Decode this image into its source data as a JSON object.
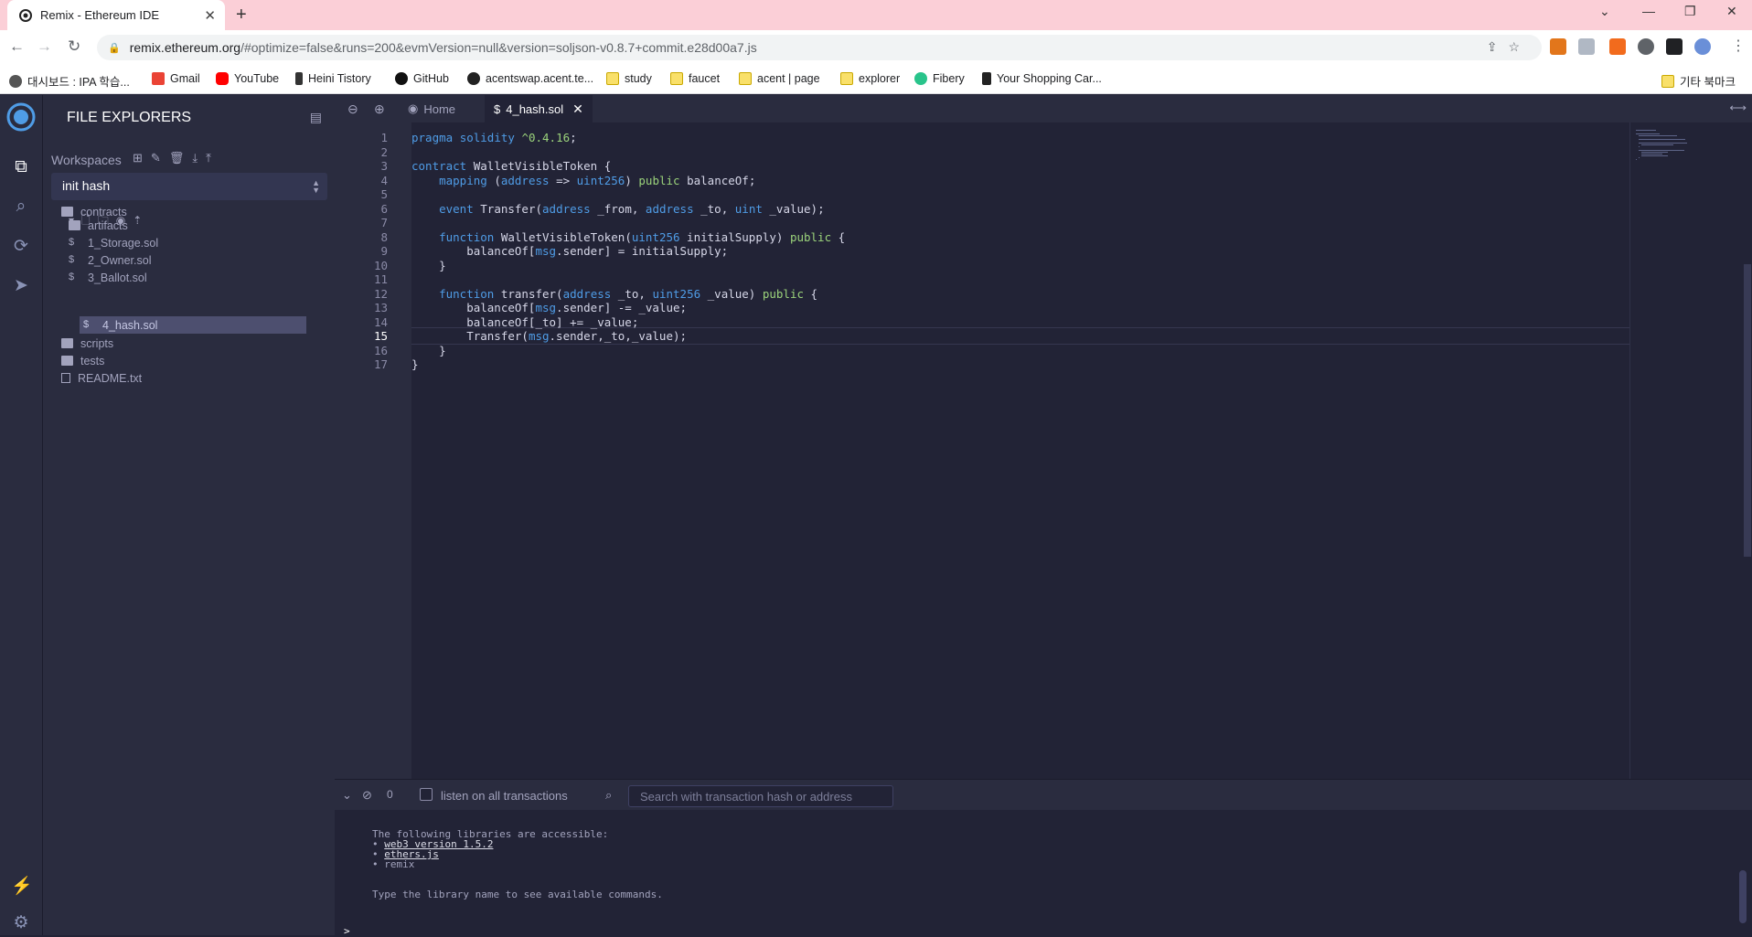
{
  "browser": {
    "tab_title": "Remix - Ethereum IDE",
    "url_host": "remix.ethereum.org",
    "url_rest": "/#optimize=false&runs=200&evmVersion=null&version=soljson-v0.8.7+commit.e28d00a7.js",
    "bookmarks": [
      "대시보드 : IPA 학습...",
      "Gmail",
      "YouTube",
      "Heini Tistory",
      "GitHub",
      "acentswap.acent.te...",
      "study",
      "faucet",
      "acent | page",
      "explorer",
      "Fibery",
      "Your Shopping Car..."
    ],
    "other_bookmarks": "기타 북마크"
  },
  "side_panel": {
    "title": "FILE EXPLORERS",
    "workspaces_label": "Workspaces",
    "workspace_selected": "init hash",
    "tree": [
      {
        "name": "contracts",
        "type": "folder"
      },
      {
        "name": "artifacts",
        "type": "folder"
      },
      {
        "name": "1_Storage.sol",
        "type": "sol"
      },
      {
        "name": "2_Owner.sol",
        "type": "sol"
      },
      {
        "name": "3_Ballot.sol",
        "type": "sol"
      },
      {
        "name": "4_hash.sol",
        "type": "sol",
        "selected": true
      },
      {
        "name": "scripts",
        "type": "folder"
      },
      {
        "name": "tests",
        "type": "folder"
      },
      {
        "name": "README.txt",
        "type": "file"
      }
    ]
  },
  "editor": {
    "tabs": [
      {
        "label": "Home",
        "active": false
      },
      {
        "label": "4_hash.sol",
        "active": true
      }
    ],
    "current_line": 15,
    "line_numbers": [
      "1",
      "2",
      "3",
      "4",
      "5",
      "6",
      "7",
      "8",
      "9",
      "10",
      "11",
      "12",
      "13",
      "14",
      "15",
      "16",
      "17"
    ],
    "code": [
      "pragma solidity ^0.4.16;",
      "",
      "contract WalletVisibleToken {",
      "    mapping (address => uint256) public balanceOf;",
      "",
      "    event Transfer(address _from, address _to, uint _value);",
      "",
      "    function WalletVisibleToken(uint256 initialSupply) public {",
      "        balanceOf[msg.sender] = initialSupply;",
      "    }",
      "",
      "    function transfer(address _to, uint256 _value) public {",
      "        balanceOf[msg.sender] -= _value;",
      "        balanceOf[_to] += _value;",
      "        Transfer(msg.sender,_to,_value);",
      "    }",
      "}"
    ]
  },
  "terminal": {
    "pending_count": "0",
    "listen_label": "listen on all transactions",
    "search_placeholder": "Search with transaction hash or address",
    "libraries_header": "The following libraries are accessible:",
    "libraries": [
      "web3 version 1.5.2",
      "ethers.js",
      "remix"
    ],
    "hint": "Type the library name to see available commands.",
    "prompt": ">"
  },
  "colors": {
    "accent": "#4f9ce6",
    "panel": "#2a2c3f",
    "editor_bg": "#222336",
    "tabstrip": "#fbcfd7"
  }
}
